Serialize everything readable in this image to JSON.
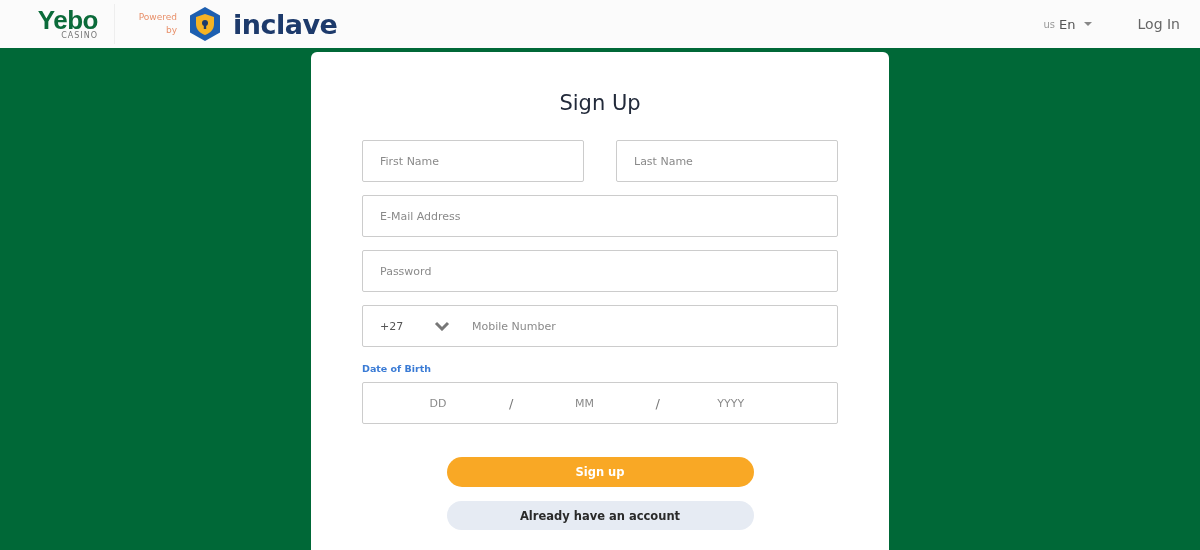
{
  "header": {
    "logo": {
      "name": "Yebo",
      "sub": "CASINO"
    },
    "powered_by": [
      "Powered",
      "by"
    ],
    "partner": "inclave",
    "language": {
      "country": "us",
      "label": "En"
    },
    "login": "Log In"
  },
  "form": {
    "title": "Sign Up",
    "name_fields": [
      {
        "placeholder": "First Name"
      },
      {
        "placeholder": "Last Name"
      }
    ],
    "email": {
      "placeholder": "E-Mail Address"
    },
    "password": {
      "placeholder": "Password"
    },
    "phone": {
      "code": "+27",
      "placeholder": "Mobile Number"
    },
    "dob": {
      "label": "Date of Birth",
      "parts": [
        {
          "placeholder": "DD"
        },
        {
          "placeholder": "MM"
        },
        {
          "placeholder": "YYYY"
        }
      ],
      "separator": "/"
    },
    "buttons": [
      {
        "label": "Sign up",
        "kind": "primary"
      },
      {
        "label": "Already have an account",
        "kind": "secondary"
      }
    ]
  }
}
